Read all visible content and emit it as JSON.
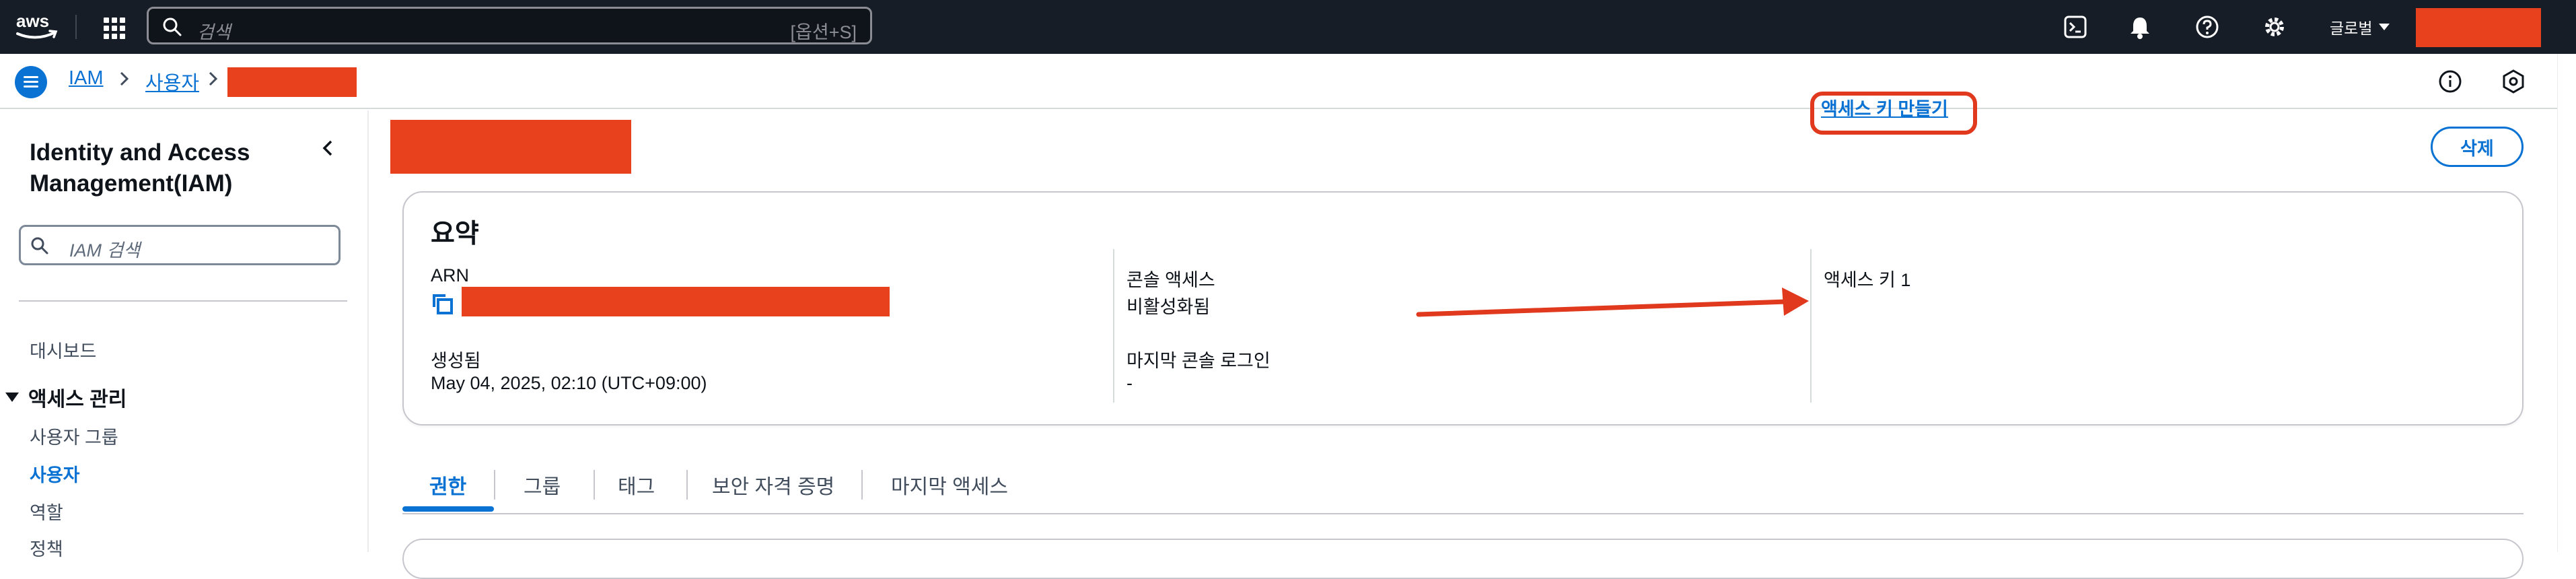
{
  "topbar": {
    "search_placeholder": "검색",
    "search_shortcut": "[옵션+S]",
    "region_label": "글로벌"
  },
  "breadcrumb": {
    "items": [
      "IAM",
      "사용자"
    ]
  },
  "sidebar": {
    "title": "Identity and Access Management(IAM)",
    "search_placeholder": "IAM 검색",
    "dashboard": "대시보드",
    "section_label": "액세스 관리",
    "items": [
      "사용자 그룹",
      "사용자",
      "역할",
      "정책"
    ]
  },
  "page": {
    "delete_label": "삭제"
  },
  "summary": {
    "heading": "요약",
    "arn_label": "ARN",
    "created_label": "생성됨",
    "created_value": "May 04, 2025, 02:10 (UTC+09:00)",
    "console_access_label": "콘솔 액세스",
    "console_access_value": "비활성화됨",
    "last_console_login_label": "마지막 콘솔 로그인",
    "last_console_login_value": "-",
    "access_key_label": "액세스 키 1",
    "create_access_key_link": "액세스 키 만들기"
  },
  "tabs": [
    "권한",
    "그룹",
    "태그",
    "보안 자격 증명",
    "마지막 액세스"
  ],
  "colors": {
    "accent": "#0972d3",
    "topbar": "#161d26",
    "redaction": "#e8411d",
    "annotation": "#e0391e"
  }
}
